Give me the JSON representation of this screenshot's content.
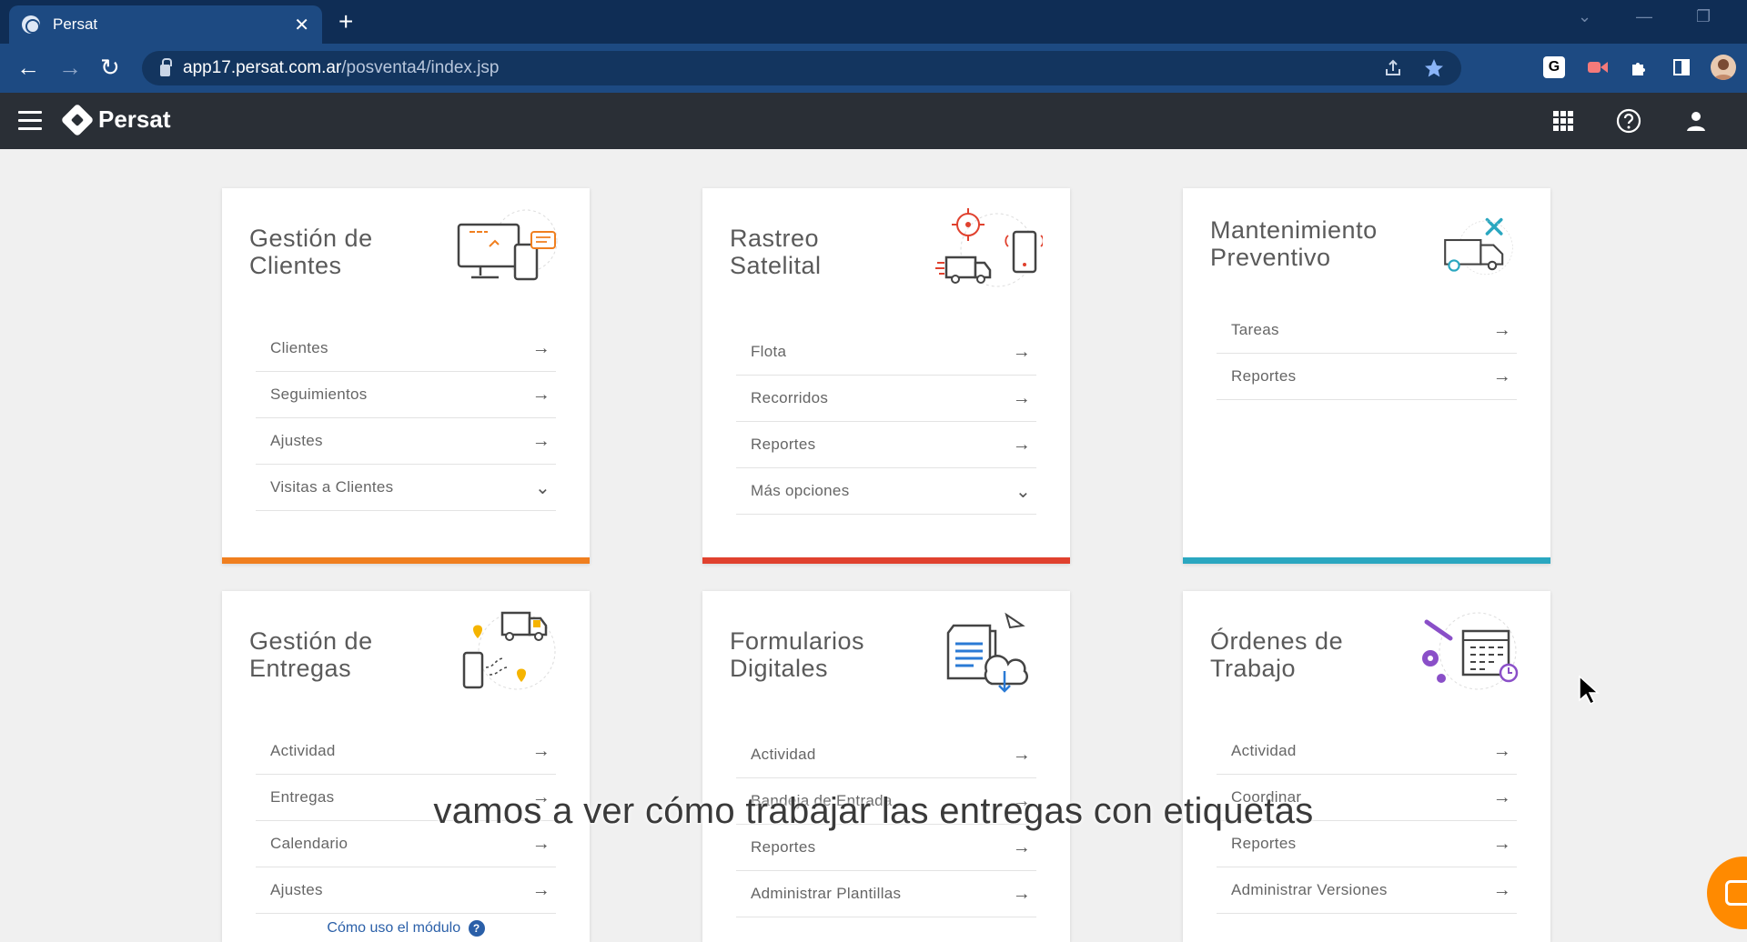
{
  "browser": {
    "tab_title": "Persat",
    "tab_close": "✕",
    "new_tab": "+",
    "url_host": "app17.persat.com.ar",
    "url_path": "/posventa4/index.jsp",
    "back": "←",
    "forward": "→",
    "reload": "↻",
    "minimize": "—",
    "restore": "❐",
    "chevron": "⌄"
  },
  "app": {
    "brand": "Persat"
  },
  "cards": [
    {
      "title": "Gestión de\nClientes",
      "accent": "#f07f1f",
      "items": [
        {
          "label": "Clientes",
          "icon": "→"
        },
        {
          "label": "Seguimientos",
          "icon": "→"
        },
        {
          "label": "Ajustes",
          "icon": "→"
        },
        {
          "label": "Visitas a Clientes",
          "icon": "⌄"
        }
      ]
    },
    {
      "title": "Rastreo\nSatelital",
      "accent": "#e0412e",
      "items": [
        {
          "label": "Flota",
          "icon": "→"
        },
        {
          "label": "Recorridos",
          "icon": "→"
        },
        {
          "label": "Reportes",
          "icon": "→"
        },
        {
          "label": "Más opciones",
          "icon": "⌄"
        }
      ]
    },
    {
      "title": "Mantenimiento\nPreventivo",
      "accent": "#2aa7c0",
      "items": [
        {
          "label": "Tareas",
          "icon": "→"
        },
        {
          "label": "Reportes",
          "icon": "→"
        }
      ]
    },
    {
      "title": "Gestión de\nEntregas",
      "accent": "#f5b400",
      "items": [
        {
          "label": "Actividad",
          "icon": "→"
        },
        {
          "label": "Entregas",
          "icon": "→"
        },
        {
          "label": "Calendario",
          "icon": "→"
        },
        {
          "label": "Ajustes",
          "icon": "→"
        }
      ],
      "help": "Cómo uso el módulo",
      "help_icon": "?"
    },
    {
      "title": "Formularios\nDigitales",
      "accent": "#2a7ad5",
      "items": [
        {
          "label": "Actividad",
          "icon": "→"
        },
        {
          "label": "Bandeja de Entrada",
          "icon": "→"
        },
        {
          "label": "Reportes",
          "icon": "→"
        },
        {
          "label": "Administrar Plantillas",
          "icon": "→"
        }
      ]
    },
    {
      "title": "Órdenes de\nTrabajo",
      "accent": "#8a4fc8",
      "items": [
        {
          "label": "Actividad",
          "icon": "→"
        },
        {
          "label": "Coordinar",
          "icon": "→"
        },
        {
          "label": "Reportes",
          "icon": "→"
        },
        {
          "label": "Administrar Versiones",
          "icon": "→"
        }
      ]
    }
  ],
  "subtitle": "vamos a ver cómo trabajar las entregas con etiquetas"
}
